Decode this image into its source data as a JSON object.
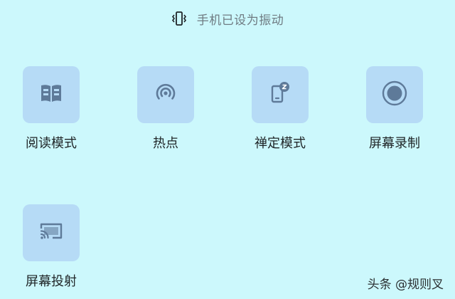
{
  "status": {
    "icon": "vibrate-icon",
    "text": "手机已设为振动"
  },
  "tiles": [
    {
      "label": "阅读模式",
      "icon": "book-icon"
    },
    {
      "label": "热点",
      "icon": "hotspot-icon"
    },
    {
      "label": "禅定模式",
      "icon": "zen-mode-icon"
    },
    {
      "label": "屏幕录制",
      "icon": "screen-record-icon"
    },
    {
      "label": "屏幕投射",
      "icon": "cast-icon"
    }
  ],
  "watermark": "头条 @规则叉",
  "colors": {
    "background": "#ccf8fc",
    "tile": "#b6dbf6",
    "icon": "#5e7a99"
  }
}
